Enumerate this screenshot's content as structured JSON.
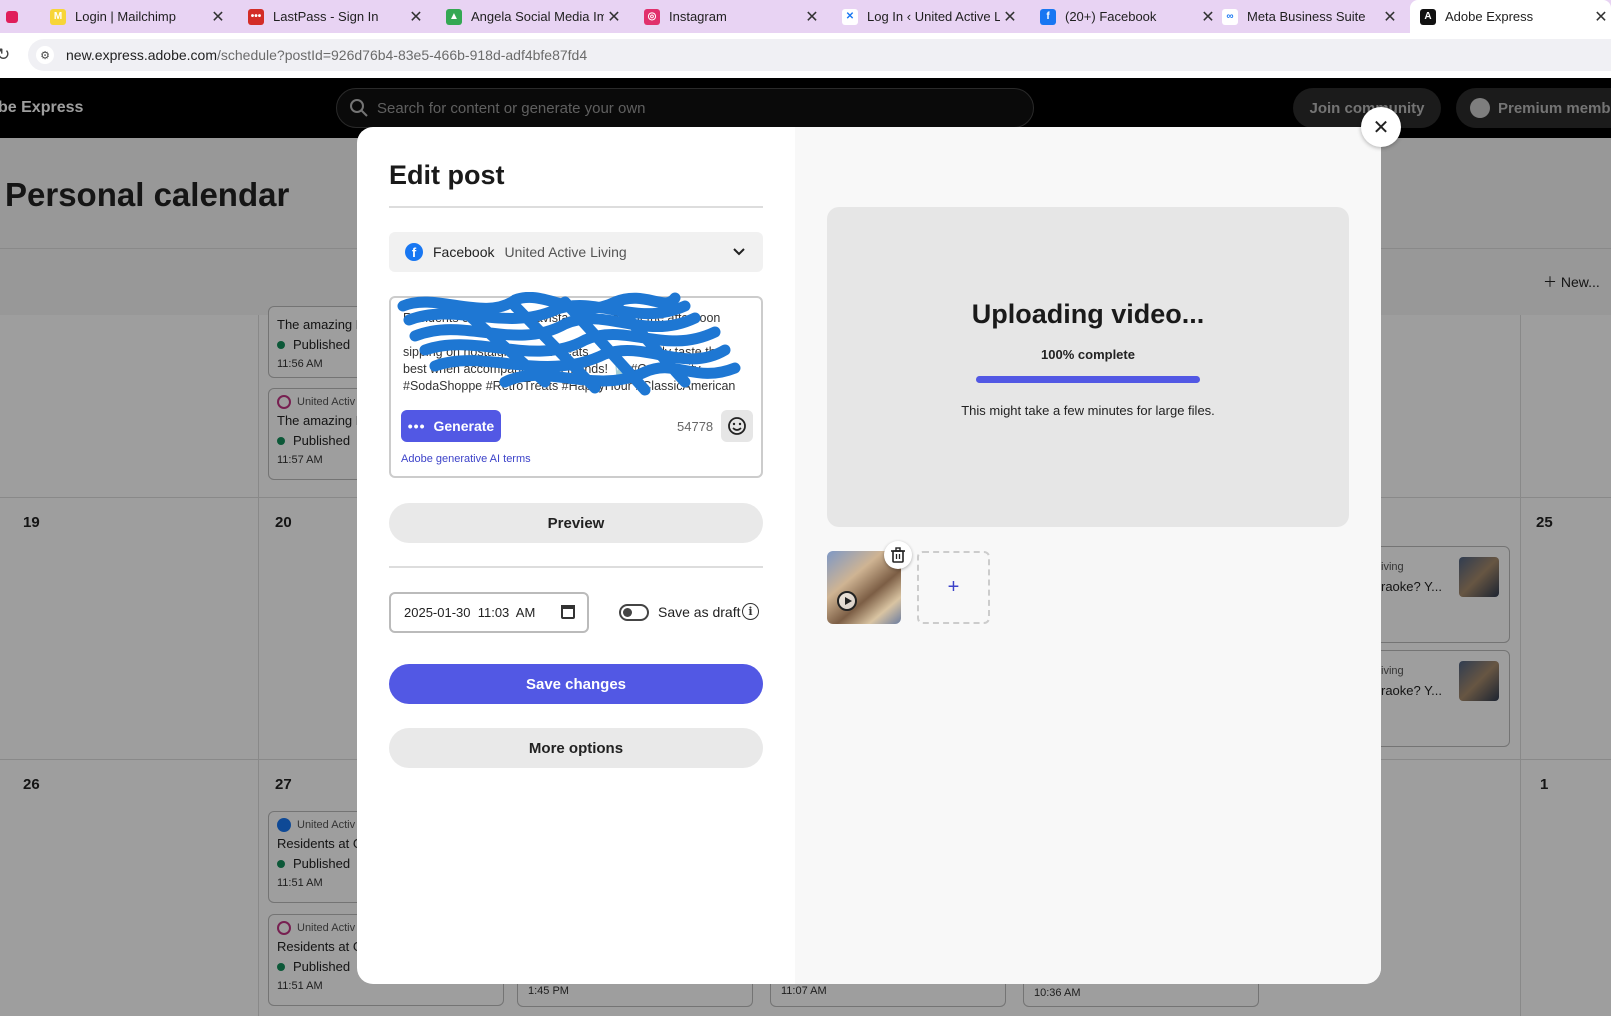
{
  "browser": {
    "tabs": [
      {
        "title": "Login | Mailchimp",
        "icon": "mailchimp-icon",
        "color": "#f7d538",
        "glyph": "M"
      },
      {
        "title": "LastPass - Sign In",
        "icon": "lastpass-icon",
        "color": "#d32d27",
        "glyph": "•••"
      },
      {
        "title": "Angela Social Media Im",
        "icon": "google-drive-icon",
        "color": "#34a853",
        "glyph": "▲"
      },
      {
        "title": "Instagram",
        "icon": "instagram-icon",
        "color": "#e1306c",
        "glyph": "◎"
      },
      {
        "title": "Log In ‹ United Active Li",
        "icon": "wordpress-icon",
        "color": "#ffffff",
        "glyph": "✕"
      },
      {
        "title": "(20+) Facebook",
        "icon": "facebook-icon",
        "color": "#1877f2",
        "glyph": "f"
      },
      {
        "title": "Meta Business Suite",
        "icon": "meta-icon",
        "color": "#ffffff",
        "glyph": "∞"
      },
      {
        "title": "Adobe Express",
        "icon": "adobe-express-icon",
        "color": "#111111",
        "glyph": "A"
      }
    ],
    "url_host": "new.express.adobe.com",
    "url_path": "/schedule?postId=926d76b4-83e5-466b-918d-adf4bfe87fd4"
  },
  "app": {
    "brand": "be Express",
    "search_placeholder": "Search for content or generate your own",
    "join_label": "Join community",
    "premium_label": "Premium memb"
  },
  "calendar": {
    "title": "Personal calendar",
    "new_label": "New...",
    "days": {
      "d19": "19",
      "d20": "20",
      "d25": "25",
      "d26": "26",
      "d27": "27",
      "d1": "1"
    },
    "cards": [
      {
        "account": "",
        "title": "The amazing E",
        "status": "Published",
        "time": "11:56 AM"
      },
      {
        "account": "United Activ",
        "title": "The amazing E",
        "status": "Published",
        "time": "11:57 AM"
      },
      {
        "account": "United Activ",
        "title": "Residents at G",
        "status": "Published",
        "time": "11:51 AM"
      },
      {
        "account": "United Activ",
        "title": "Residents at G",
        "status": "Published",
        "time": "11:51 AM"
      }
    ],
    "right_cards": [
      {
        "line1": "iving",
        "line2": "raoke? Y..."
      },
      {
        "line1": "iving",
        "line2": "raoke? Y..."
      }
    ],
    "bottom_times": [
      "1:45 PM",
      "11:07 AM",
      "10:36 AM"
    ]
  },
  "modal": {
    "title": "Edit post",
    "account_network": "Facebook",
    "account_name": "United Active Living",
    "caption_lines": [
      "Residents of Lake Buenavista Village spent the afternoon",
      "sipping on nostalgic classic treats ... which really taste the",
      "best when accompanied with friends! 🥤 #Community",
      "#SodaShoppe #RetroTreats #HappyHour #ClassicAmerican"
    ],
    "generate_label": "Generate",
    "char_count": "54778",
    "ai_terms_label": "Adobe generative AI terms",
    "preview_label": "Preview",
    "date_value": "2025-01-30  11:03  AM",
    "draft_label": "Save as draft",
    "save_label": "Save changes",
    "more_label": "More options",
    "upload_title": "Uploading video...",
    "upload_percent_label": "100% complete",
    "upload_progress": 1.0,
    "upload_note": "This might take a few minutes for large files.",
    "add_media_label": "+"
  },
  "colors": {
    "accent": "#5258e4",
    "tab_bar": "#e8d3f3",
    "published": "#148f5b"
  }
}
